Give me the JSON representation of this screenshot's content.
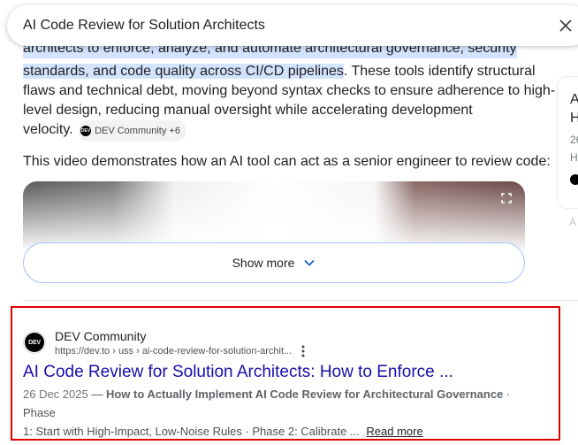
{
  "search": {
    "query": "AI Code Review for Solution Architects"
  },
  "overview": {
    "line0": "architects to enforce, analyze, and automate architectural governance, security",
    "line1_hl": "standards, and code quality across CI/CD pipelines",
    "line1_rest": ". These tools identify structural",
    "line2": "flaws and technical debt, moving beyond syntax checks to ensure adherence to high-",
    "line3": "level design, reducing manual oversight while accelerating development",
    "line4": "velocity.",
    "source_chip": "DEV Community +6",
    "chip_logo": "DEV",
    "video_intro": "This video demonstrates how an AI tool can act as a senior engineer to review code:",
    "show_more": "Show more"
  },
  "side_panel": {
    "t1": "A",
    "t2": "H",
    "t3": "26",
    "t4": "H",
    "t5": "A"
  },
  "result": {
    "favicon": "DEV",
    "site_name": "DEV Community",
    "url": "https://dev.to › uss › ai-code-review-for-solution-archit...",
    "title": "AI Code Review for Solution Architects: How to Enforce ...",
    "date": "26 Dec 2025",
    "dash": " — ",
    "bold": "How to Actually Implement AI Code Review for Architectural Governance",
    "snippet_1": " · Phase",
    "snippet_2": "1: Start with High-Impact, Low-Noise Rules · Phase 2: Calibrate ... ",
    "read_more": "Read more"
  },
  "colors": {
    "link": "#1a0dab",
    "highlight": "#d3e3fd",
    "annotation_border": "#e00000"
  }
}
